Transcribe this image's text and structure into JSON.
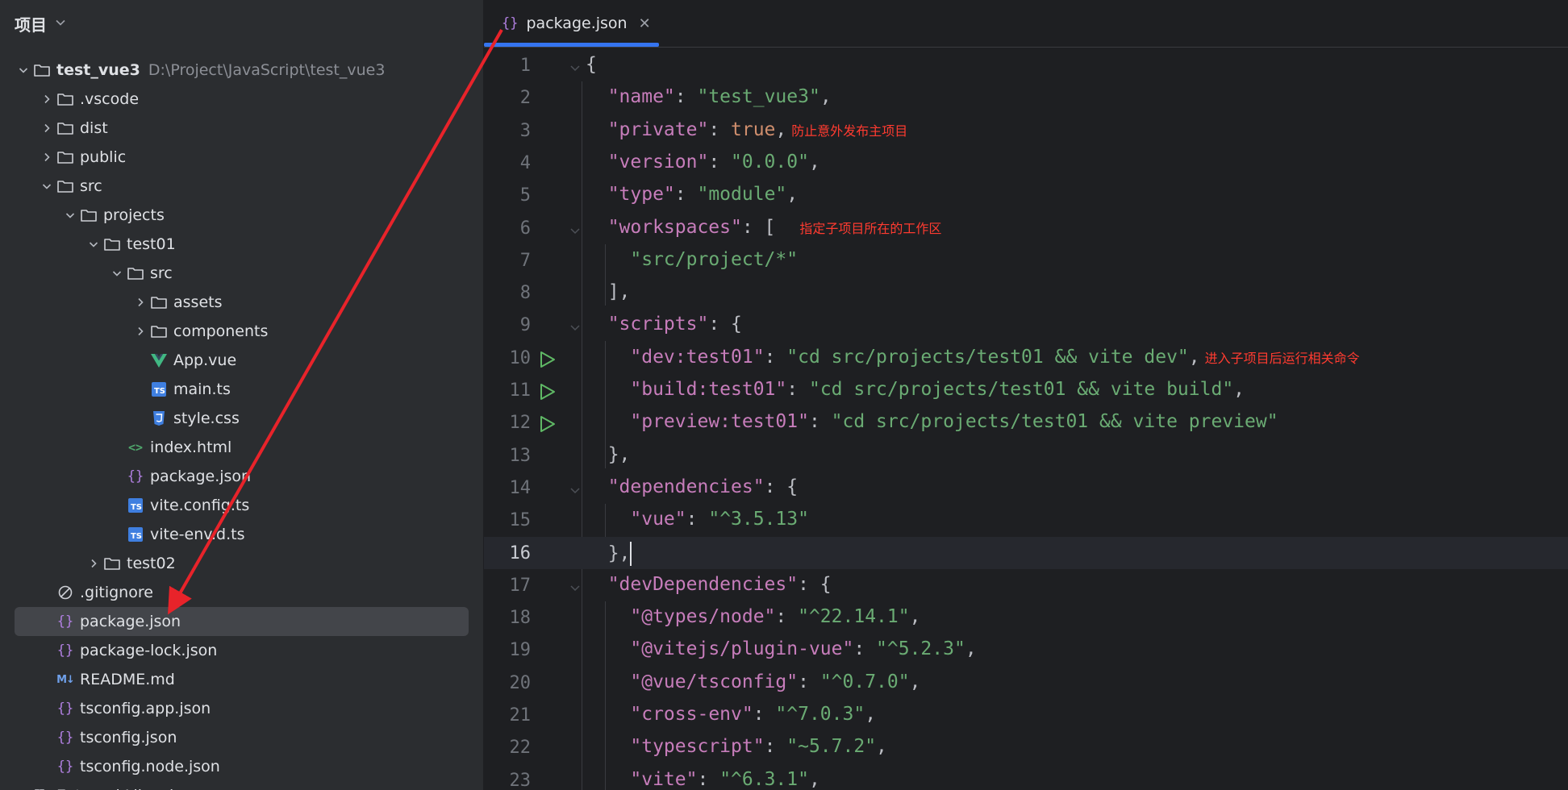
{
  "sidebar": {
    "title": "项目",
    "tree": [
      {
        "label": "test_vue3",
        "path": "D:\\Project\\JavaScript\\test_vue3",
        "depth": 0,
        "arrow": "down",
        "icon": "folder",
        "bold": true
      },
      {
        "label": ".vscode",
        "depth": 1,
        "arrow": "right",
        "icon": "folder"
      },
      {
        "label": "dist",
        "depth": 1,
        "arrow": "right",
        "icon": "folder"
      },
      {
        "label": "public",
        "depth": 1,
        "arrow": "right",
        "icon": "folder"
      },
      {
        "label": "src",
        "depth": 1,
        "arrow": "down",
        "icon": "folder"
      },
      {
        "label": "projects",
        "depth": 2,
        "arrow": "down",
        "icon": "folder"
      },
      {
        "label": "test01",
        "depth": 3,
        "arrow": "down",
        "icon": "folder"
      },
      {
        "label": "src",
        "depth": 4,
        "arrow": "down",
        "icon": "folder"
      },
      {
        "label": "assets",
        "depth": 5,
        "arrow": "right",
        "icon": "folder"
      },
      {
        "label": "components",
        "depth": 5,
        "arrow": "right",
        "icon": "folder"
      },
      {
        "label": "App.vue",
        "depth": 5,
        "arrow": "none",
        "icon": "vue"
      },
      {
        "label": "main.ts",
        "depth": 5,
        "arrow": "none",
        "icon": "ts"
      },
      {
        "label": "style.css",
        "depth": 5,
        "arrow": "none",
        "icon": "css"
      },
      {
        "label": "index.html",
        "depth": 4,
        "arrow": "none",
        "icon": "html"
      },
      {
        "label": "package.json",
        "depth": 4,
        "arrow": "none",
        "icon": "json"
      },
      {
        "label": "vite.config.ts",
        "depth": 4,
        "arrow": "none",
        "icon": "ts"
      },
      {
        "label": "vite-env.d.ts",
        "depth": 4,
        "arrow": "none",
        "icon": "ts"
      },
      {
        "label": "test02",
        "depth": 3,
        "arrow": "right",
        "icon": "folder"
      },
      {
        "label": ".gitignore",
        "depth": 1,
        "arrow": "none",
        "icon": "ignore"
      },
      {
        "label": "package.json",
        "depth": 1,
        "arrow": "none",
        "icon": "json",
        "selected": true
      },
      {
        "label": "package-lock.json",
        "depth": 1,
        "arrow": "none",
        "icon": "json"
      },
      {
        "label": "README.md",
        "depth": 1,
        "arrow": "none",
        "icon": "md"
      },
      {
        "label": "tsconfig.app.json",
        "depth": 1,
        "arrow": "none",
        "icon": "json"
      },
      {
        "label": "tsconfig.json",
        "depth": 1,
        "arrow": "none",
        "icon": "json"
      },
      {
        "label": "tsconfig.node.json",
        "depth": 1,
        "arrow": "none",
        "icon": "json"
      },
      {
        "label": "External Libraries",
        "depth": 0,
        "arrow": "right",
        "icon": "library"
      }
    ]
  },
  "tab": {
    "label": "package.json",
    "icon": "json-braces-icon"
  },
  "editor": {
    "current_line": 16,
    "lines": [
      {
        "n": 1,
        "fold": true,
        "run": false,
        "indent": 0,
        "tokens": [
          [
            "p",
            "{"
          ]
        ]
      },
      {
        "n": 2,
        "indent": 1,
        "tokens": [
          [
            "k",
            "\"name\""
          ],
          [
            "p",
            ": "
          ],
          [
            "s",
            "\"test_vue3\""
          ],
          [
            "p",
            ","
          ]
        ]
      },
      {
        "n": 3,
        "indent": 1,
        "tokens": [
          [
            "k",
            "\"private\""
          ],
          [
            "p",
            ": "
          ],
          [
            "b",
            "true"
          ],
          [
            "p",
            ","
          ]
        ],
        "annotation": "防止意外发布主项目"
      },
      {
        "n": 4,
        "indent": 1,
        "tokens": [
          [
            "k",
            "\"version\""
          ],
          [
            "p",
            ": "
          ],
          [
            "s",
            "\"0.0.0\""
          ],
          [
            "p",
            ","
          ]
        ]
      },
      {
        "n": 5,
        "indent": 1,
        "tokens": [
          [
            "k",
            "\"type\""
          ],
          [
            "p",
            ": "
          ],
          [
            "s",
            "\"module\""
          ],
          [
            "p",
            ","
          ]
        ]
      },
      {
        "n": 6,
        "fold": true,
        "indent": 1,
        "tokens": [
          [
            "k",
            "\"workspaces\""
          ],
          [
            "p",
            ": ["
          ]
        ],
        "annotation": "指定子项目所在的工作区",
        "annotation_gap": true
      },
      {
        "n": 7,
        "indent": 2,
        "tokens": [
          [
            "s",
            "\"src/project/*\""
          ]
        ]
      },
      {
        "n": 8,
        "indent": 1,
        "tokens": [
          [
            "p",
            "],"
          ]
        ]
      },
      {
        "n": 9,
        "fold": true,
        "indent": 1,
        "tokens": [
          [
            "k",
            "\"scripts\""
          ],
          [
            "p",
            ": {"
          ]
        ]
      },
      {
        "n": 10,
        "run": true,
        "indent": 2,
        "tokens": [
          [
            "k",
            "\"dev:test01\""
          ],
          [
            "p",
            ": "
          ],
          [
            "s",
            "\"cd src/projects/test01 && vite dev\""
          ],
          [
            "p",
            ","
          ]
        ],
        "annotation": "进入子项目后运行相关命令"
      },
      {
        "n": 11,
        "run": true,
        "indent": 2,
        "tokens": [
          [
            "k",
            "\"build:test01\""
          ],
          [
            "p",
            ": "
          ],
          [
            "s",
            "\"cd src/projects/test01 && vite build\""
          ],
          [
            "p",
            ","
          ]
        ]
      },
      {
        "n": 12,
        "run": true,
        "indent": 2,
        "tokens": [
          [
            "k",
            "\"preview:test01\""
          ],
          [
            "p",
            ": "
          ],
          [
            "s",
            "\"cd src/projects/test01 && vite preview\""
          ]
        ]
      },
      {
        "n": 13,
        "indent": 1,
        "tokens": [
          [
            "p",
            "},"
          ]
        ]
      },
      {
        "n": 14,
        "fold": true,
        "indent": 1,
        "tokens": [
          [
            "k",
            "\"dependencies\""
          ],
          [
            "p",
            ": {"
          ]
        ]
      },
      {
        "n": 15,
        "indent": 2,
        "tokens": [
          [
            "k",
            "\"vue\""
          ],
          [
            "p",
            ": "
          ],
          [
            "s",
            "\"^3.5.13\""
          ]
        ]
      },
      {
        "n": 16,
        "indent": 1,
        "tokens": [
          [
            "p",
            "},"
          ]
        ],
        "cursor": true
      },
      {
        "n": 17,
        "fold": true,
        "indent": 1,
        "tokens": [
          [
            "k",
            "\"devDependencies\""
          ],
          [
            "p",
            ": {"
          ]
        ]
      },
      {
        "n": 18,
        "indent": 2,
        "tokens": [
          [
            "k",
            "\"@types/node\""
          ],
          [
            "p",
            ": "
          ],
          [
            "s",
            "\"^22.14.1\""
          ],
          [
            "p",
            ","
          ]
        ]
      },
      {
        "n": 19,
        "indent": 2,
        "tokens": [
          [
            "k",
            "\"@vitejs/plugin-vue\""
          ],
          [
            "p",
            ": "
          ],
          [
            "s",
            "\"^5.2.3\""
          ],
          [
            "p",
            ","
          ]
        ]
      },
      {
        "n": 20,
        "indent": 2,
        "tokens": [
          [
            "k",
            "\"@vue/tsconfig\""
          ],
          [
            "p",
            ": "
          ],
          [
            "s",
            "\"^0.7.0\""
          ],
          [
            "p",
            ","
          ]
        ]
      },
      {
        "n": 21,
        "indent": 2,
        "tokens": [
          [
            "k",
            "\"cross-env\""
          ],
          [
            "p",
            ": "
          ],
          [
            "s",
            "\"^7.0.3\""
          ],
          [
            "p",
            ","
          ]
        ]
      },
      {
        "n": 22,
        "indent": 2,
        "tokens": [
          [
            "k",
            "\"typescript\""
          ],
          [
            "p",
            ": "
          ],
          [
            "s",
            "\"~5.7.2\""
          ],
          [
            "p",
            ","
          ]
        ]
      },
      {
        "n": 23,
        "indent": 2,
        "tokens": [
          [
            "k",
            "\"vite\""
          ],
          [
            "p",
            ": "
          ],
          [
            "s",
            "\"^6.3.1\""
          ],
          [
            "p",
            ","
          ]
        ]
      }
    ]
  },
  "colors": {
    "accent": "#3574f0",
    "annotation": "#ff3b30",
    "string": "#6aab73",
    "key": "#c77dbb",
    "keyword": "#cf8e6d"
  }
}
